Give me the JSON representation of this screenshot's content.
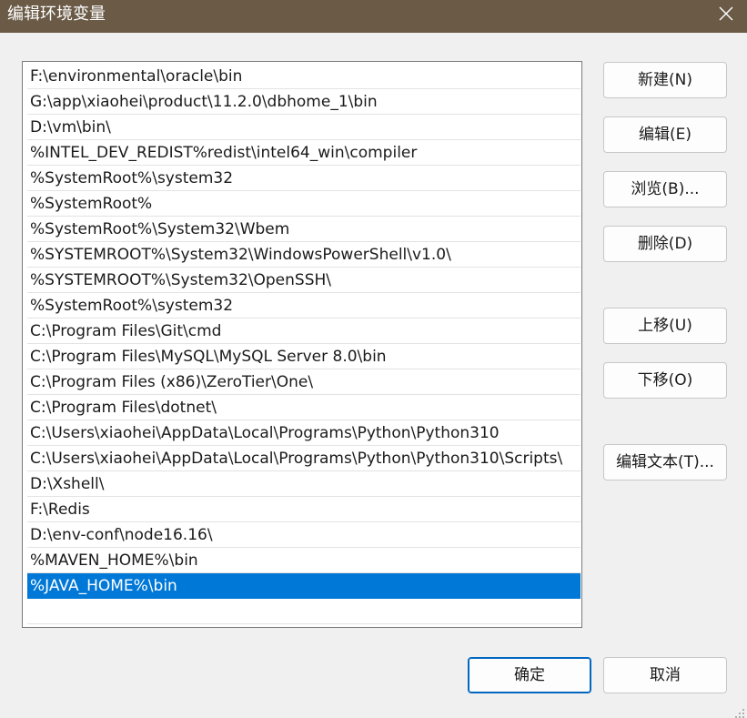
{
  "window": {
    "title": "编辑环境变量",
    "colors": {
      "titlebar": "#6a5a46",
      "selection": "#0078d7",
      "primary_border": "#0067c0"
    }
  },
  "path_list": {
    "items": [
      "F:\\environmental\\oracle\\bin",
      "G:\\app\\xiaohei\\product\\11.2.0\\dbhome_1\\bin",
      "D:\\vm\\bin\\",
      "%INTEL_DEV_REDIST%redist\\intel64_win\\compiler",
      "%SystemRoot%\\system32",
      "%SystemRoot%",
      "%SystemRoot%\\System32\\Wbem",
      "%SYSTEMROOT%\\System32\\WindowsPowerShell\\v1.0\\",
      "%SYSTEMROOT%\\System32\\OpenSSH\\",
      "%SystemRoot%\\system32",
      "C:\\Program Files\\Git\\cmd",
      "C:\\Program Files\\MySQL\\MySQL Server 8.0\\bin",
      "C:\\Program Files (x86)\\ZeroTier\\One\\",
      "C:\\Program Files\\dotnet\\",
      "C:\\Users\\xiaohei\\AppData\\Local\\Programs\\Python\\Python310",
      "C:\\Users\\xiaohei\\AppData\\Local\\Programs\\Python\\Python310\\Scripts\\",
      "D:\\Xshell\\",
      "F:\\Redis",
      "D:\\env-conf\\node16.16\\",
      "%MAVEN_HOME%\\bin",
      "%JAVA_HOME%\\bin"
    ],
    "selected_index": 20
  },
  "buttons": {
    "new": "新建(N)",
    "edit": "编辑(E)",
    "browse": "浏览(B)...",
    "delete": "删除(D)",
    "move_up": "上移(U)",
    "move_down": "下移(O)",
    "edit_text": "编辑文本(T)...",
    "ok": "确定",
    "cancel": "取消"
  },
  "icons": {
    "close": "close-icon",
    "resize": "resize-grip-icon"
  }
}
